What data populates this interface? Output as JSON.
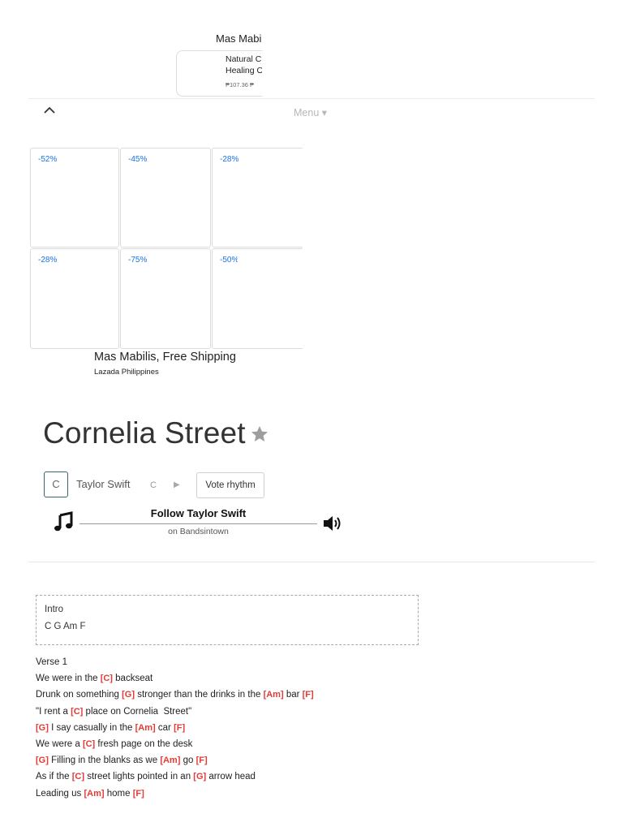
{
  "top_ad": {
    "title": "Mas Mabilis, Free Shipping",
    "line1": "Natural Cure",
    "line2": "Healing Oil",
    "price": "₱107.36 ₱"
  },
  "nav": {
    "menu_label": "Menu ▾"
  },
  "grid_ad": {
    "discounts": [
      "-52%",
      "-45%",
      "-28%",
      "-28%",
      "-75%",
      "-50%"
    ],
    "headline": "Mas Mabilis, Free Shipping",
    "source": "Lazada Philippines",
    "adchoices_info": "ⓘ",
    "adchoices_close": "✕"
  },
  "song": {
    "title": "Cornelia Street",
    "key_button": "C",
    "artist": "Taylor Swift",
    "key_letter": "C",
    "play_glyph": "▶",
    "vote_label": "Vote rhythm"
  },
  "bandsintown": {
    "follow_label": "Follow Taylor Swift",
    "sub_label": "on Bandsintown"
  },
  "chords": {
    "intro_label": "Intro",
    "intro_chords": "C G Am F",
    "verse_label": "Verse 1",
    "lines": [
      [
        {
          "t": "We were in the "
        },
        {
          "c": "[C]"
        },
        {
          "t": " backseat"
        }
      ],
      [
        {
          "t": "Drunk on something "
        },
        {
          "c": "[G]"
        },
        {
          "t": " stronger than the drinks in the "
        },
        {
          "c": "[Am]"
        },
        {
          "t": " bar  "
        },
        {
          "c": "[F]"
        }
      ],
      [
        {
          "t": "\"I rent a "
        },
        {
          "c": "[C]"
        },
        {
          "t": " place on Cornelia  Street\""
        }
      ],
      [
        {
          "t": " "
        },
        {
          "c": "[G]"
        },
        {
          "t": " I say casually in the "
        },
        {
          "c": "[Am]"
        },
        {
          "t": " car  "
        },
        {
          "c": "[F]"
        }
      ],
      [
        {
          "t": "We were a "
        },
        {
          "c": "[C]"
        },
        {
          "t": " fresh page on the desk"
        }
      ],
      [
        {
          "t": " "
        },
        {
          "c": "[G]"
        },
        {
          "t": " Filling in the blanks as we "
        },
        {
          "c": "[Am]"
        },
        {
          "t": " go  "
        },
        {
          "c": "[F]"
        }
      ],
      [
        {
          "t": "As if the "
        },
        {
          "c": "[C]"
        },
        {
          "t": " street lights pointed in an "
        },
        {
          "c": "[G]"
        },
        {
          "t": " arrow head"
        }
      ],
      [
        {
          "t": "Leading us "
        },
        {
          "c": "[Am]"
        },
        {
          "t": " home "
        },
        {
          "c": "[F]"
        }
      ]
    ]
  },
  "colors": {
    "chord": "#e53935",
    "discount": "#1a73e8",
    "adchoices": "#00aecd",
    "key_border": "#37676e"
  }
}
